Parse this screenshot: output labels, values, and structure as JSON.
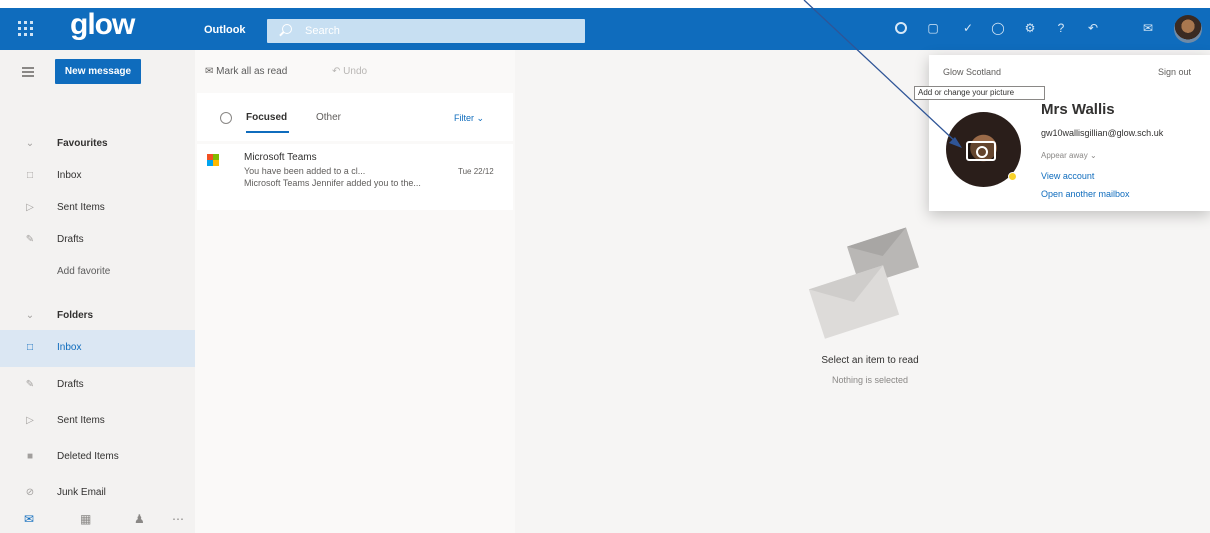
{
  "header": {
    "logo": "glow",
    "app_name": "Outlook",
    "search_placeholder": "Search"
  },
  "command_bar": {
    "new_message": "New message",
    "mark_all_read": "Mark all as read",
    "undo": "Undo"
  },
  "sidebar": {
    "favourites": "Favourites",
    "favourite_items": [
      {
        "label": "Inbox",
        "icon": "inbox-icon"
      },
      {
        "label": "Sent Items",
        "icon": "send-icon"
      },
      {
        "label": "Drafts",
        "icon": "pencil-icon"
      }
    ],
    "add_favourite": "Add favorite",
    "folders": "Folders",
    "folder_items": [
      {
        "label": "Inbox",
        "icon": "inbox-icon",
        "selected": true
      },
      {
        "label": "Drafts",
        "icon": "pencil-icon"
      },
      {
        "label": "Sent Items",
        "icon": "send-icon"
      },
      {
        "label": "Deleted Items",
        "icon": "trash-icon"
      },
      {
        "label": "Junk Email",
        "icon": "junk-icon"
      }
    ]
  },
  "message_list": {
    "tabs": [
      "Focused",
      "Other"
    ],
    "active_tab": "Focused",
    "filter": "Filter",
    "messages": [
      {
        "sender": "Microsoft Teams",
        "subject_preview": "You have been added to a cl...",
        "date": "Tue 22/12",
        "body_preview": "Microsoft Teams Jennifer added you to the..."
      }
    ]
  },
  "reading_pane": {
    "title": "Select an item to read",
    "subtitle": "Nothing is selected"
  },
  "account_card": {
    "organisation": "Glow Scotland",
    "sign_out": "Sign out",
    "tooltip": "Add or change your picture",
    "name": "Mrs Wallis",
    "email": "gw10wallisgillian@glow.sch.uk",
    "status": "Appear away",
    "view_account": "View account",
    "open_mailbox": "Open another mailbox"
  },
  "colors": {
    "brand": "#0f6cbd",
    "presence_away": "#f8d22a"
  }
}
